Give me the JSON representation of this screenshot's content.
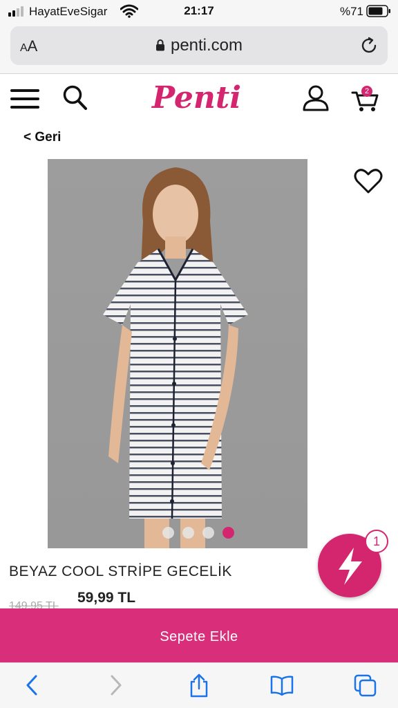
{
  "status_bar": {
    "carrier": "HayatEveSigar",
    "time": "21:17",
    "battery": "%71"
  },
  "browser": {
    "text_size_label_small": "A",
    "text_size_label_large": "A",
    "url": "penti.com"
  },
  "header": {
    "logo_text": "Penti",
    "cart_count": "2"
  },
  "back_link": "< Geri",
  "product": {
    "title": "BEYAZ COOL STRİPE GECELİK",
    "old_price": "149,95 TL",
    "price": "59,99 TL",
    "image_count": 4,
    "active_image_index": 3
  },
  "fab": {
    "badge": "1"
  },
  "add_to_cart_label": "Sepete Ekle",
  "colors": {
    "brand": "#d4266f",
    "button": "#d92e7a",
    "browser_blue": "#1a73e8"
  },
  "icons": {
    "menu": "menu-icon",
    "search": "search-icon",
    "user": "user-icon",
    "cart": "cart-icon",
    "heart": "heart-icon",
    "lightning": "lightning-icon",
    "back": "back-arrow-icon",
    "forward": "forward-arrow-icon",
    "share": "share-icon",
    "bookmarks": "bookmarks-icon",
    "tabs": "tabs-icon"
  }
}
